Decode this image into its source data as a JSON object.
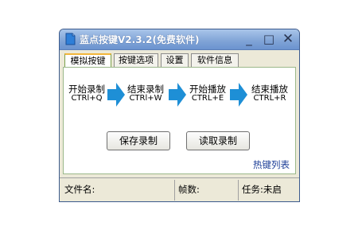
{
  "window": {
    "title": "蓝点按键V2.3.2(免费软件)",
    "minimize_glyph": "_",
    "maximize_glyph": "□",
    "close_glyph": "✕",
    "icon": "app-document-icon"
  },
  "tabs": [
    {
      "label": "模拟按键",
      "active": true
    },
    {
      "label": "按键选项",
      "active": false
    },
    {
      "label": "设置",
      "active": false
    },
    {
      "label": "软件信息",
      "active": false
    }
  ],
  "flow": [
    {
      "label": "开始录制",
      "hotkey": "CTRl+Q"
    },
    {
      "label": "结束录制",
      "hotkey": "CTRl+W"
    },
    {
      "label": "开始播放",
      "hotkey": "CTRL+E"
    },
    {
      "label": "结束播放",
      "hotkey": "CTRL+R"
    }
  ],
  "buttons": {
    "save_recording": "保存录制",
    "load_recording": "读取录制"
  },
  "hotkey_list_link": "热键列表",
  "status": {
    "file_label": "文件名:",
    "frames_label": "帧数:",
    "task_label": "任务:未启"
  },
  "colors": {
    "arrow": "#1e8fd6",
    "title_gradient_top": "#a9c5ea",
    "link": "#1a3c96"
  }
}
